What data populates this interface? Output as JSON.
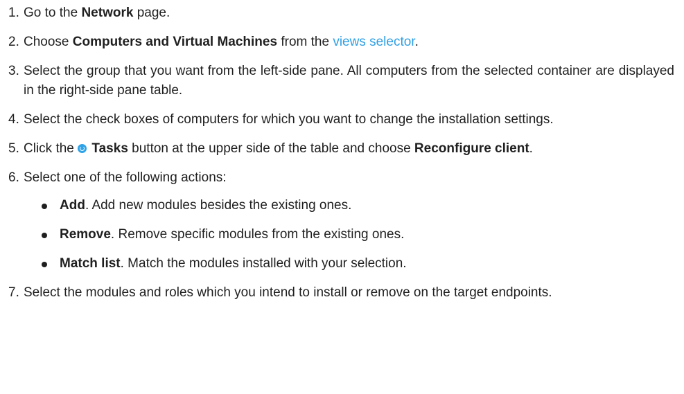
{
  "steps": [
    {
      "num": "1.",
      "pre": "Go to the ",
      "bold": "Network",
      "post": " page."
    },
    {
      "num": "2.",
      "pre": "Choose ",
      "bold": "Computers and Virtual Machines",
      "mid": " from the ",
      "link": "views selector",
      "post": "."
    },
    {
      "num": "3.",
      "text": "Select the group that you want from the left-side pane. All computers from the selected container are displayed in the right-side pane table."
    },
    {
      "num": "4.",
      "text": "Select the check boxes of computers for which you want to change the installation settings."
    },
    {
      "num": "5.",
      "pre": "Click the ",
      "icon": "tasks-icon",
      "bold": "Tasks",
      "mid": " button at the upper side of the table and choose ",
      "bold2": "Reconfigure client",
      "post": "."
    },
    {
      "num": "6.",
      "text": "Select one of the following actions:"
    },
    {
      "num": "7.",
      "text": "Select the modules and roles which you intend to install or remove on the target endpoints."
    }
  ],
  "actions": [
    {
      "bold": "Add",
      "text": ". Add new modules besides the existing ones."
    },
    {
      "bold": "Remove",
      "text": ". Remove specific modules from the existing ones."
    },
    {
      "bold": "Match list",
      "text": ". Match the modules installed with your selection."
    }
  ],
  "colors": {
    "text": "#1f1f1f",
    "link": "#2f9fe4",
    "icon": "#2ea3e8"
  }
}
